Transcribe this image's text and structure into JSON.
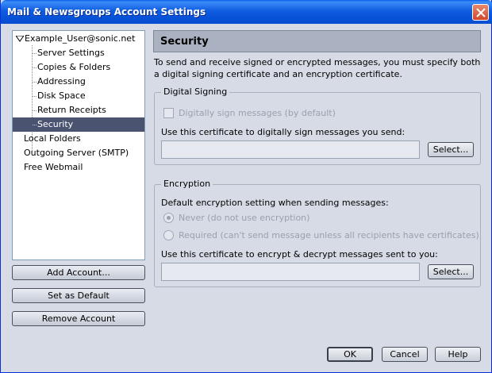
{
  "window": {
    "title": "Mail & Newsgroups Account Settings"
  },
  "tree": {
    "items": [
      {
        "label": "Example_User@sonic.net",
        "level": 0,
        "expanded": true
      },
      {
        "label": "Server Settings",
        "level": 1
      },
      {
        "label": "Copies & Folders",
        "level": 1
      },
      {
        "label": "Addressing",
        "level": 1
      },
      {
        "label": "Disk Space",
        "level": 1
      },
      {
        "label": "Return Receipts",
        "level": 1
      },
      {
        "label": "Security",
        "level": 1,
        "selected": true
      },
      {
        "label": "Local Folders",
        "level": 0
      },
      {
        "label": "Outgoing Server (SMTP)",
        "level": 0
      },
      {
        "label": "Free Webmail",
        "level": 0
      }
    ]
  },
  "left_buttons": {
    "add": "Add Account...",
    "default": "Set as Default",
    "remove": "Remove Account"
  },
  "panel": {
    "title": "Security",
    "description": "To send and receive signed or encrypted messages, you must specify both a digital signing certificate and an encryption certificate."
  },
  "signing": {
    "legend": "Digital Signing",
    "checkbox_label": "Digitally sign messages (by default)",
    "checkbox_checked": false,
    "cert_label": "Use this certificate to digitally sign messages you send:",
    "cert_value": "",
    "select_label": "Select..."
  },
  "encryption": {
    "legend": "Encryption",
    "default_label": "Default encryption setting when sending messages:",
    "option_never": "Never (do not use encryption)",
    "option_required": "Required (can't send message unless all recipients have certificates)",
    "selected_option": "never",
    "cert_label": "Use this certificate to encrypt & decrypt messages sent to you:",
    "cert_value": "",
    "select_label": "Select..."
  },
  "footer": {
    "ok": "OK",
    "cancel": "Cancel",
    "help": "Help"
  },
  "colors": {
    "titlebar": "#0a5fe8",
    "selected_row": "#4a5470",
    "header_bg": "#aab2c2"
  }
}
